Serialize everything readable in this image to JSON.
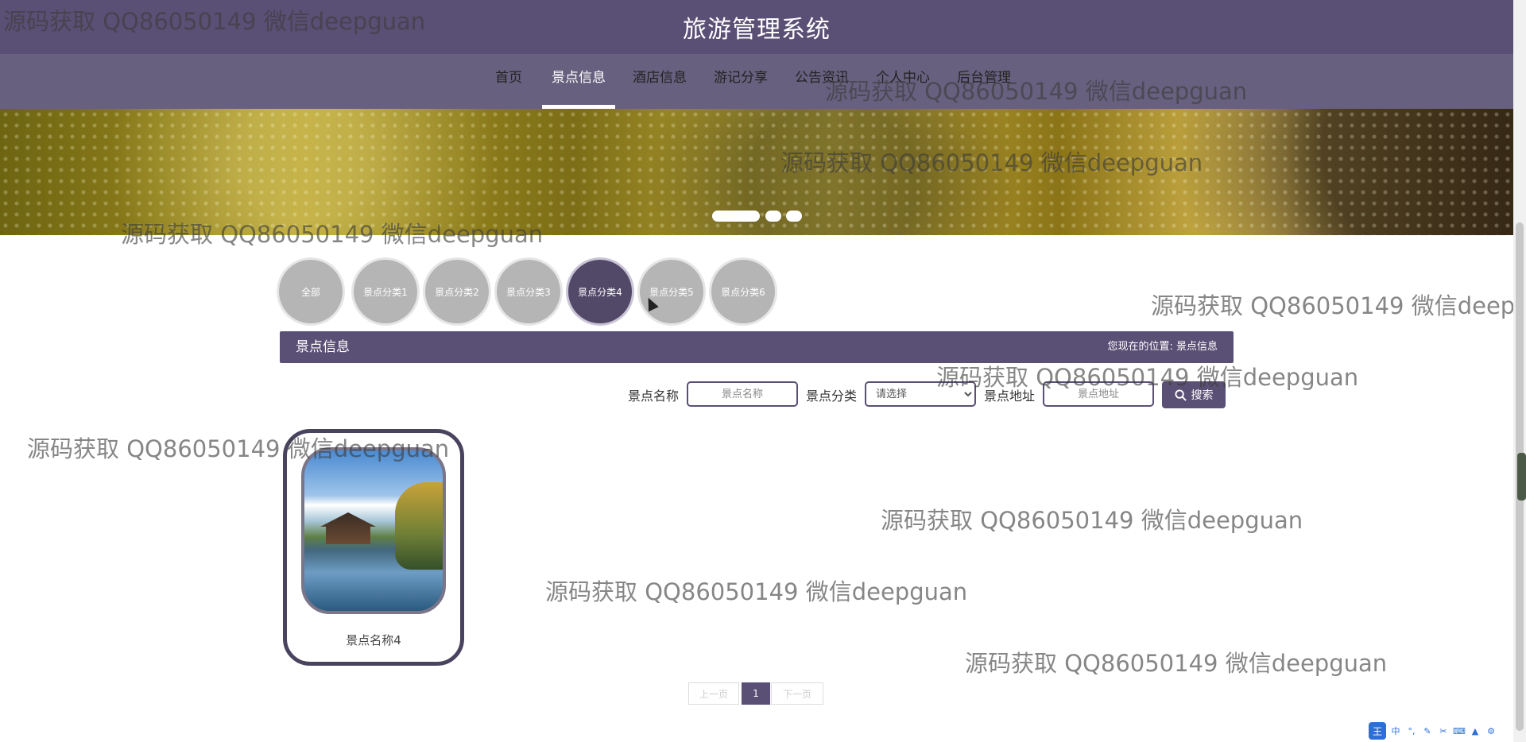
{
  "app": {
    "title": "旅游管理系统"
  },
  "nav": {
    "items": [
      {
        "label": "首页",
        "active": false
      },
      {
        "label": "景点信息",
        "active": true
      },
      {
        "label": "酒店信息",
        "active": false
      },
      {
        "label": "游记分享",
        "active": false
      },
      {
        "label": "公告资讯",
        "active": false
      },
      {
        "label": "个人中心",
        "active": false
      },
      {
        "label": "后台管理",
        "active": false
      }
    ]
  },
  "banner": {
    "slide_count": 3,
    "active_slide": 1
  },
  "categories": {
    "items": [
      {
        "label": "全部",
        "active": false
      },
      {
        "label": "景点分类1",
        "active": false
      },
      {
        "label": "景点分类2",
        "active": false
      },
      {
        "label": "景点分类3",
        "active": false
      },
      {
        "label": "景点分类4",
        "active": true
      },
      {
        "label": "景点分类5",
        "active": false
      },
      {
        "label": "景点分类6",
        "active": false
      }
    ]
  },
  "section": {
    "title": "景点信息",
    "breadcrumb_prefix": "您现在的位置:",
    "breadcrumb_current": "景点信息"
  },
  "search": {
    "name_label": "景点名称",
    "name_placeholder": "景点名称",
    "category_label": "景点分类",
    "category_selected": "请选择",
    "address_label": "景点地址",
    "address_placeholder": "景点地址",
    "button_label": "搜索",
    "button_icon": "search-icon"
  },
  "results": [
    {
      "name": "景点名称4",
      "image": "lake-pavilion-photo"
    }
  ],
  "pagination": {
    "prev_label": "上一页",
    "current_page": "1",
    "next_label": "下一页"
  },
  "watermark": {
    "text": "源码获取 QQ86050149 微信deepguan"
  },
  "taskbar": {
    "ime_label": "王",
    "ime_mode": "中",
    "icons": [
      "punctuation-icon",
      "pen-icon",
      "scissors-icon",
      "keyboard-icon",
      "shirt-icon",
      "settings-icon"
    ]
  },
  "colors": {
    "primary": "#5a4f74",
    "nav": "#67607f",
    "accent_white": "#ffffff"
  }
}
